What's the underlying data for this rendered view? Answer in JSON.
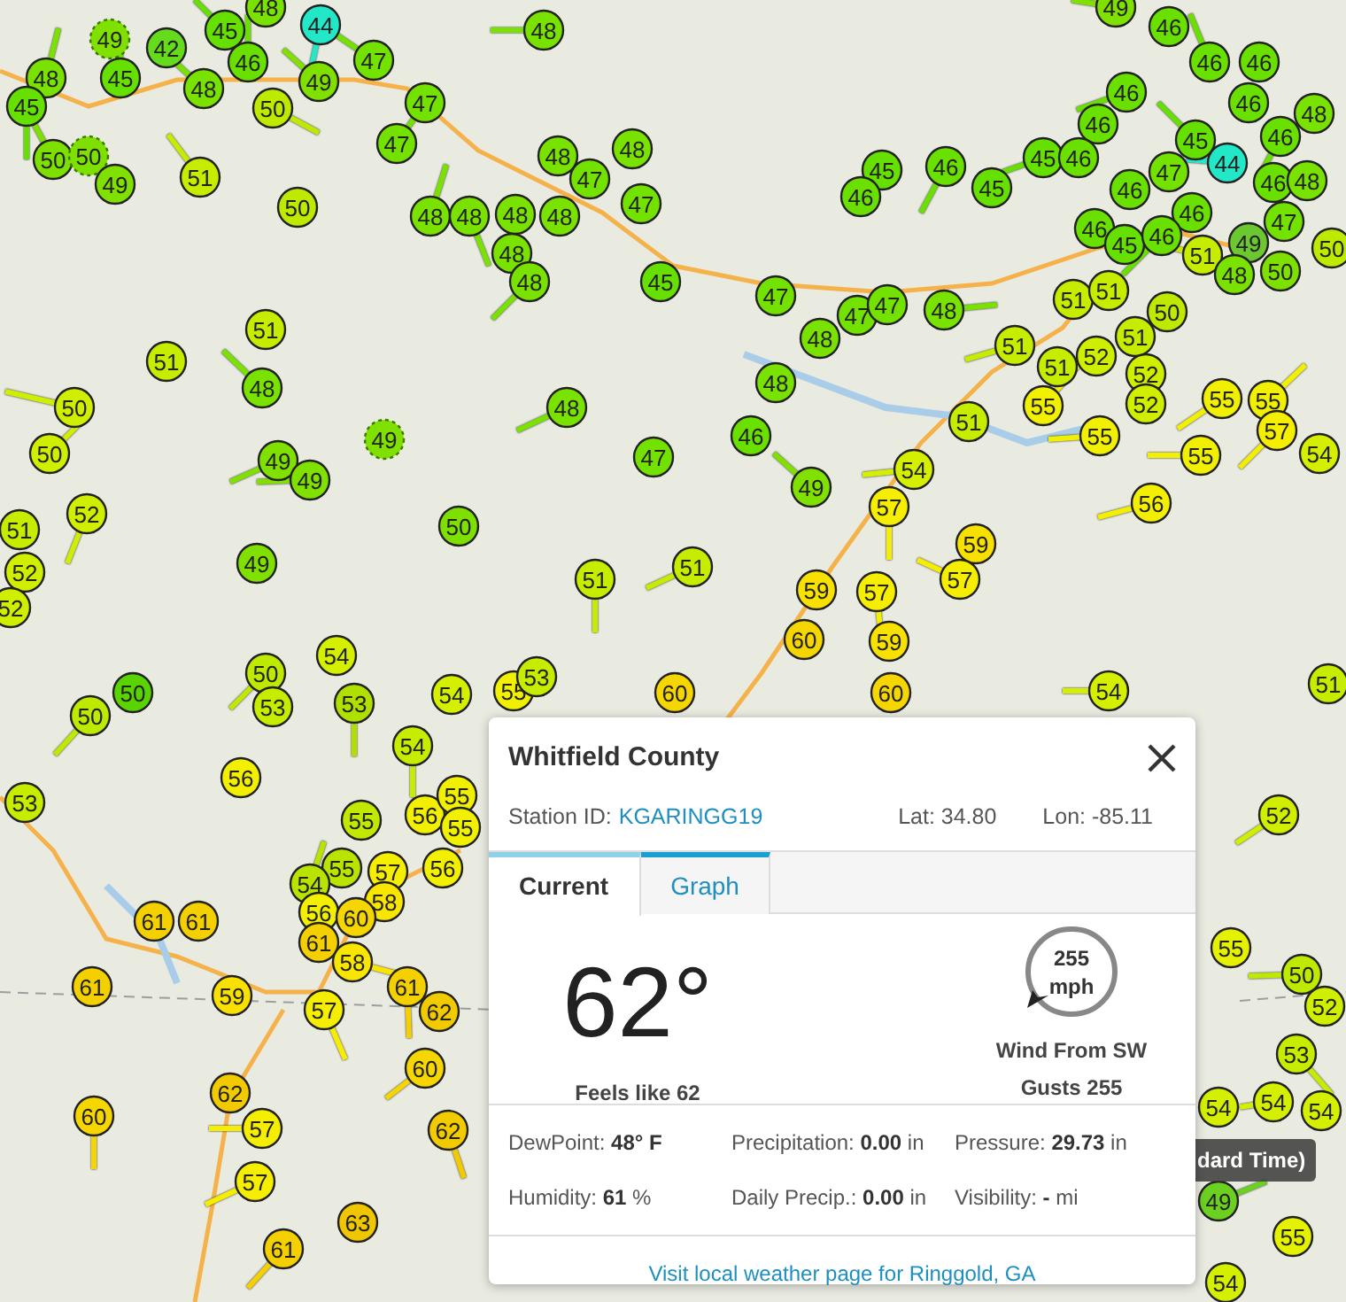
{
  "map": {
    "markers": [
      {
        "value": "45",
        "color": "#66e000",
        "kind": "solid"
      },
      {
        "value": "48",
        "color": "#7ae200",
        "kind": "solid"
      },
      {
        "value": "44",
        "color": "#22e8c8",
        "kind": "solid"
      },
      {
        "value": "48",
        "color": "#7ae200",
        "kind": "solid"
      },
      {
        "value": "49",
        "color": "#80e000",
        "kind": "dashed"
      },
      {
        "value": "42",
        "color": "#64dc1c",
        "kind": "solid"
      },
      {
        "value": "47",
        "color": "#74e200",
        "kind": "solid"
      },
      {
        "value": "48",
        "color": "#7ae200",
        "kind": "solid"
      },
      {
        "value": "45",
        "color": "#66e000",
        "kind": "solid"
      },
      {
        "value": "46",
        "color": "#6ae000",
        "kind": "solid"
      },
      {
        "value": "48",
        "color": "#7ae200",
        "kind": "solid"
      },
      {
        "value": "49",
        "color": "#80e000",
        "kind": "solid"
      },
      {
        "value": "50",
        "color": "#bdea00",
        "kind": "solid"
      },
      {
        "value": "47",
        "color": "#74e200",
        "kind": "solid"
      },
      {
        "value": "47",
        "color": "#74e200",
        "kind": "solid"
      },
      {
        "value": "45",
        "color": "#66e000",
        "kind": "solid"
      },
      {
        "value": "50",
        "color": "#7ee000",
        "kind": "solid"
      },
      {
        "value": "50",
        "color": "#7ee000",
        "kind": "dashed"
      },
      {
        "value": "49",
        "color": "#80e000",
        "kind": "solid"
      },
      {
        "value": "51",
        "color": "#c6ec00",
        "kind": "solid"
      },
      {
        "value": "50",
        "color": "#bdea00",
        "kind": "solid"
      },
      {
        "value": "48",
        "color": "#7ae200",
        "kind": "solid"
      },
      {
        "value": "48",
        "color": "#7ae200",
        "kind": "solid"
      },
      {
        "value": "47",
        "color": "#74e200",
        "kind": "solid"
      },
      {
        "value": "47",
        "color": "#74e200",
        "kind": "solid"
      },
      {
        "value": "48",
        "color": "#7ae200",
        "kind": "solid"
      },
      {
        "value": "48",
        "color": "#7ae200",
        "kind": "solid"
      },
      {
        "value": "48",
        "color": "#7ae200",
        "kind": "solid"
      },
      {
        "value": "48",
        "color": "#7ae200",
        "kind": "solid"
      },
      {
        "value": "48",
        "color": "#7ae200",
        "kind": "solid"
      },
      {
        "value": "48",
        "color": "#7ae200",
        "kind": "solid"
      },
      {
        "value": "45",
        "color": "#66e000",
        "kind": "solid"
      },
      {
        "value": "51",
        "color": "#c6ec00",
        "kind": "solid"
      },
      {
        "value": "51",
        "color": "#c6ec00",
        "kind": "solid"
      },
      {
        "value": "48",
        "color": "#7ae200",
        "kind": "solid"
      },
      {
        "value": "48",
        "color": "#7ae200",
        "kind": "solid"
      },
      {
        "value": "49",
        "color": "#80e000",
        "kind": "dashed"
      },
      {
        "value": "47",
        "color": "#74e200",
        "kind": "solid"
      },
      {
        "value": "50",
        "color": "#d0ee00",
        "kind": "solid"
      },
      {
        "value": "50",
        "color": "#d0ee00",
        "kind": "solid"
      },
      {
        "value": "49",
        "color": "#80e000",
        "kind": "solid"
      },
      {
        "value": "49",
        "color": "#80e000",
        "kind": "solid"
      },
      {
        "value": "50",
        "color": "#7ee000",
        "kind": "solid"
      },
      {
        "value": "51",
        "color": "#c6ec00",
        "kind": "solid"
      },
      {
        "value": "52",
        "color": "#d0ee00",
        "kind": "solid"
      },
      {
        "value": "52",
        "color": "#d0ee00",
        "kind": "solid"
      },
      {
        "value": "52",
        "color": "#d0ee00",
        "kind": "solid"
      },
      {
        "value": "49",
        "color": "#80e000",
        "kind": "solid"
      },
      {
        "value": "51",
        "color": "#c6ec00",
        "kind": "solid"
      },
      {
        "value": "51",
        "color": "#c6ec00",
        "kind": "solid"
      },
      {
        "value": "49",
        "color": "#80e000",
        "kind": "solid"
      },
      {
        "value": "46",
        "color": "#6ae000",
        "kind": "solid"
      },
      {
        "value": "46",
        "color": "#6ae000",
        "kind": "solid"
      },
      {
        "value": "46",
        "color": "#6ae000",
        "kind": "solid"
      },
      {
        "value": "46",
        "color": "#6ae000",
        "kind": "solid"
      },
      {
        "value": "48",
        "color": "#7ae200",
        "kind": "solid"
      },
      {
        "value": "46",
        "color": "#6ae000",
        "kind": "solid"
      },
      {
        "value": "46",
        "color": "#6ae000",
        "kind": "solid"
      },
      {
        "value": "45",
        "color": "#66e000",
        "kind": "solid"
      },
      {
        "value": "45",
        "color": "#66e000",
        "kind": "solid"
      },
      {
        "value": "46",
        "color": "#6ae000",
        "kind": "solid"
      },
      {
        "value": "45",
        "color": "#66e000",
        "kind": "solid"
      },
      {
        "value": "46",
        "color": "#6ae000",
        "kind": "solid"
      },
      {
        "value": "46",
        "color": "#6ae000",
        "kind": "solid"
      },
      {
        "value": "45",
        "color": "#66e000",
        "kind": "solid"
      },
      {
        "value": "44",
        "color": "#22e8c8",
        "kind": "solid"
      },
      {
        "value": "47",
        "color": "#74e200",
        "kind": "solid"
      },
      {
        "value": "46",
        "color": "#6ae000",
        "kind": "solid"
      },
      {
        "value": "46",
        "color": "#6ae000",
        "kind": "solid"
      },
      {
        "value": "46",
        "color": "#6ae000",
        "kind": "solid"
      },
      {
        "value": "48",
        "color": "#7ae200",
        "kind": "solid"
      },
      {
        "value": "46",
        "color": "#6ae000",
        "kind": "solid"
      },
      {
        "value": "46",
        "color": "#6ae000",
        "kind": "solid"
      },
      {
        "value": "45",
        "color": "#66e000",
        "kind": "solid"
      },
      {
        "value": "46",
        "color": "#6ae000",
        "kind": "solid"
      },
      {
        "value": "51",
        "color": "#c6ec00",
        "kind": "solid"
      },
      {
        "value": "49",
        "color": "#6cc830",
        "kind": "solid"
      },
      {
        "value": "47",
        "color": "#74e200",
        "kind": "solid"
      },
      {
        "value": "48",
        "color": "#7ae200",
        "kind": "solid"
      },
      {
        "value": "50",
        "color": "#7ee000",
        "kind": "solid"
      },
      {
        "value": "50",
        "color": "#bdea00",
        "kind": "solid"
      },
      {
        "value": "47",
        "color": "#74e200",
        "kind": "solid"
      },
      {
        "value": "47",
        "color": "#74e200",
        "kind": "solid"
      },
      {
        "value": "47",
        "color": "#74e200",
        "kind": "solid"
      },
      {
        "value": "48",
        "color": "#7ae200",
        "kind": "solid"
      },
      {
        "value": "48",
        "color": "#7ae200",
        "kind": "solid"
      },
      {
        "value": "48",
        "color": "#7ae200",
        "kind": "solid"
      },
      {
        "value": "46",
        "color": "#6ae000",
        "kind": "solid"
      },
      {
        "value": "49",
        "color": "#80e000",
        "kind": "solid"
      },
      {
        "value": "51",
        "color": "#c6ec00",
        "kind": "solid"
      },
      {
        "value": "51",
        "color": "#c6ec00",
        "kind": "solid"
      },
      {
        "value": "50",
        "color": "#bdea00",
        "kind": "solid"
      },
      {
        "value": "51",
        "color": "#c6ec00",
        "kind": "solid"
      },
      {
        "value": "51",
        "color": "#c6ec00",
        "kind": "solid"
      },
      {
        "value": "51",
        "color": "#c6ec00",
        "kind": "solid"
      },
      {
        "value": "52",
        "color": "#d0ee00",
        "kind": "solid"
      },
      {
        "value": "55",
        "color": "#f0f000",
        "kind": "solid"
      },
      {
        "value": "52",
        "color": "#d0ee00",
        "kind": "solid"
      },
      {
        "value": "52",
        "color": "#d0ee00",
        "kind": "solid"
      },
      {
        "value": "55",
        "color": "#f0f000",
        "kind": "solid"
      },
      {
        "value": "55",
        "color": "#f0f000",
        "kind": "solid"
      },
      {
        "value": "55",
        "color": "#f0f000",
        "kind": "solid"
      },
      {
        "value": "57",
        "color": "#f6ee00",
        "kind": "solid"
      },
      {
        "value": "55",
        "color": "#f0f000",
        "kind": "solid"
      },
      {
        "value": "54",
        "color": "#d4f000",
        "kind": "solid"
      },
      {
        "value": "51",
        "color": "#c6ec00",
        "kind": "solid"
      },
      {
        "value": "54",
        "color": "#d4f000",
        "kind": "solid"
      },
      {
        "value": "57",
        "color": "#f6ee00",
        "kind": "solid"
      },
      {
        "value": "56",
        "color": "#f2f000",
        "kind": "solid"
      },
      {
        "value": "59",
        "color": "#f8e000",
        "kind": "solid"
      },
      {
        "value": "57",
        "color": "#f6ee00",
        "kind": "solid"
      },
      {
        "value": "59",
        "color": "#f8e000",
        "kind": "solid"
      },
      {
        "value": "60",
        "color": "#f6d600",
        "kind": "solid"
      },
      {
        "value": "57",
        "color": "#f6ee00",
        "kind": "solid"
      },
      {
        "value": "59",
        "color": "#f8e000",
        "kind": "solid"
      },
      {
        "value": "50",
        "color": "#5ad400",
        "kind": "solid"
      },
      {
        "value": "50",
        "color": "#bdea00",
        "kind": "solid"
      },
      {
        "value": "50",
        "color": "#bdea00",
        "kind": "solid"
      },
      {
        "value": "53",
        "color": "#c6ec00",
        "kind": "solid"
      },
      {
        "value": "54",
        "color": "#d4f000",
        "kind": "solid"
      },
      {
        "value": "53",
        "color": "#b0e000",
        "kind": "solid"
      },
      {
        "value": "54",
        "color": "#d4f000",
        "kind": "solid"
      },
      {
        "value": "54",
        "color": "#c6ec00",
        "kind": "solid"
      },
      {
        "value": "56",
        "color": "#f2f000",
        "kind": "solid"
      },
      {
        "value": "53",
        "color": "#c6ec00",
        "kind": "solid"
      },
      {
        "value": "55",
        "color": "#c0e800",
        "kind": "solid"
      },
      {
        "value": "56",
        "color": "#f2f000",
        "kind": "solid"
      },
      {
        "value": "55",
        "color": "#f0f000",
        "kind": "solid"
      },
      {
        "value": "55",
        "color": "#f0f000",
        "kind": "solid"
      },
      {
        "value": "55",
        "color": "#b8e400",
        "kind": "solid"
      },
      {
        "value": "57",
        "color": "#f6ee00",
        "kind": "solid"
      },
      {
        "value": "54",
        "color": "#b8e400",
        "kind": "solid"
      },
      {
        "value": "56",
        "color": "#f2f000",
        "kind": "solid"
      },
      {
        "value": "58",
        "color": "#f8e600",
        "kind": "solid"
      },
      {
        "value": "56",
        "color": "#f2f000",
        "kind": "solid"
      },
      {
        "value": "60",
        "color": "#f6d600",
        "kind": "solid"
      },
      {
        "value": "61",
        "color": "#f4d000",
        "kind": "solid"
      },
      {
        "value": "58",
        "color": "#f8e600",
        "kind": "solid"
      },
      {
        "value": "61",
        "color": "#f4d000",
        "kind": "solid"
      },
      {
        "value": "61",
        "color": "#f4d000",
        "kind": "solid"
      },
      {
        "value": "61",
        "color": "#f4d000",
        "kind": "solid"
      },
      {
        "value": "59",
        "color": "#f8e000",
        "kind": "solid"
      },
      {
        "value": "57",
        "color": "#f6ee00",
        "kind": "solid"
      },
      {
        "value": "61",
        "color": "#f4d000",
        "kind": "solid"
      },
      {
        "value": "62",
        "color": "#f2ca00",
        "kind": "solid"
      },
      {
        "value": "60",
        "color": "#f6d600",
        "kind": "solid"
      },
      {
        "value": "62",
        "color": "#f2ca00",
        "kind": "solid"
      },
      {
        "value": "57",
        "color": "#f6ee00",
        "kind": "solid"
      },
      {
        "value": "57",
        "color": "#f6ee00",
        "kind": "solid"
      },
      {
        "value": "60",
        "color": "#f6d600",
        "kind": "solid"
      },
      {
        "value": "62",
        "color": "#f2ca00",
        "kind": "solid"
      },
      {
        "value": "63",
        "color": "#f0c600",
        "kind": "solid"
      },
      {
        "value": "61",
        "color": "#f4d000",
        "kind": "solid"
      },
      {
        "value": "51",
        "color": "#c6ec00",
        "kind": "solid"
      },
      {
        "value": "52",
        "color": "#d0ee00",
        "kind": "solid"
      },
      {
        "value": "55",
        "color": "#e4f200",
        "kind": "solid"
      },
      {
        "value": "50",
        "color": "#bdea00",
        "kind": "solid"
      },
      {
        "value": "52",
        "color": "#d0ee00",
        "kind": "solid"
      },
      {
        "value": "53",
        "color": "#c6ec00",
        "kind": "solid"
      },
      {
        "value": "54",
        "color": "#d4f000",
        "kind": "solid"
      },
      {
        "value": "54",
        "color": "#d4f000",
        "kind": "solid"
      },
      {
        "value": "54",
        "color": "#d4f000",
        "kind": "solid"
      },
      {
        "value": "49",
        "color": "#6cd020",
        "kind": "solid"
      },
      {
        "value": "55",
        "color": "#e4f200",
        "kind": "solid"
      },
      {
        "value": "54",
        "color": "#d4f000",
        "kind": "solid"
      },
      {
        "value": "55",
        "color": "#f0f000",
        "kind": "solid"
      },
      {
        "value": "60",
        "color": "#f6d600",
        "kind": "solid"
      },
      {
        "value": "60",
        "color": "#f6d600",
        "kind": "solid"
      },
      {
        "value": "53",
        "color": "#c6ec00",
        "kind": "solid"
      },
      {
        "value": "54",
        "color": "#d4f000",
        "kind": "solid"
      }
    ],
    "tooltip": "dard Time)"
  },
  "popup": {
    "title": "Whitfield County",
    "station_label": "Station ID:",
    "station_id": "KGARINGG19",
    "lat": "Lat: 34.80",
    "lon": "Lon: -85.11",
    "tabs": [
      {
        "label": "Current",
        "selected": true
      },
      {
        "label": "Graph",
        "selected": false
      }
    ],
    "temperature": "62°",
    "feels_like": "Feels like 62",
    "wind": {
      "speed": "255",
      "unit": "mph",
      "direction": "Wind From **SW**",
      "gusts": "Gusts **255**"
    },
    "details": [
      "DewPoint: **48° F**",
      "Precipitation: **0.00** in",
      "Pressure: **29.73** in",
      "Humidity: **61** %",
      "Daily Precip.: **0.00** in",
      "Visibility: **-** mi"
    ],
    "link": "Visit local weather page for Ringgold, GA"
  }
}
